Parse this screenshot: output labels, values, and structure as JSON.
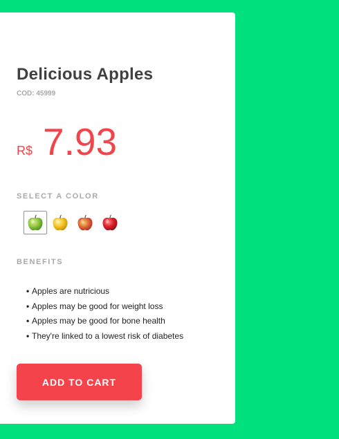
{
  "product": {
    "title": "Delicious Apples",
    "code": "COD: 45999",
    "currency": "R$",
    "price": "7.93"
  },
  "color_section": {
    "label": "SELECT A COLOR",
    "options": [
      {
        "icon": "green-apple-icon",
        "color": "#8cc43e",
        "selected": true
      },
      {
        "icon": "yellow-apple-icon",
        "color": "#f2c21b",
        "selected": false
      },
      {
        "icon": "red-yellow-apple-icon",
        "color": "#e0683a",
        "selected": false
      },
      {
        "icon": "red-apple-icon",
        "color": "#e0222d",
        "selected": false
      }
    ]
  },
  "benefits": {
    "label": "BENEFITS",
    "items": [
      "Apples are nutricious",
      "Apples may be good for weight loss",
      "Apples may be good for bone health",
      "They're linked to a lowest risk of diabetes"
    ]
  },
  "cart_button": {
    "label": "ADD TO CART"
  },
  "colors": {
    "background": "#00e07c",
    "accent": "#f4434a",
    "price": "#f0464b"
  }
}
